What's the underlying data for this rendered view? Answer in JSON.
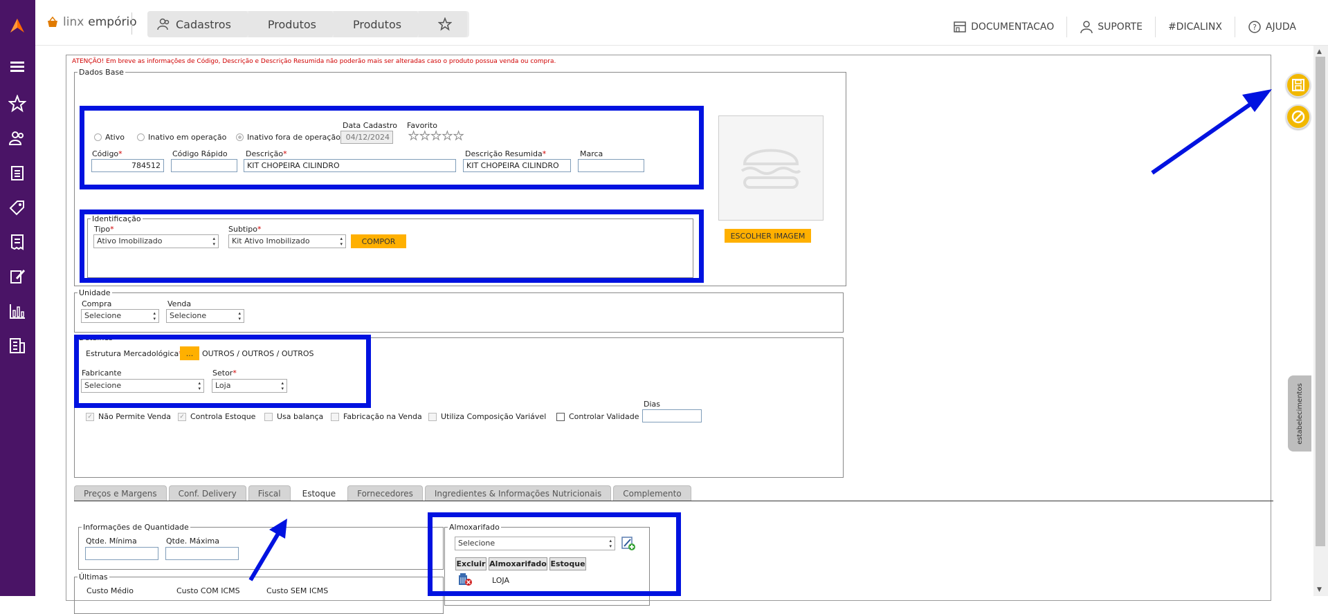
{
  "app": {
    "brand_left": "linx",
    "brand_right": "empório"
  },
  "breadcrumb": [
    "Cadastros",
    "Produtos",
    "Produtos"
  ],
  "top_links": {
    "docs": "DOCUMENTACAO",
    "support": "SUPORTE",
    "dica": "#DICALINX",
    "help": "AJUDA"
  },
  "sidebar_icons": [
    "menu-icon",
    "star-icon",
    "users-icon",
    "clipboard-icon",
    "tag-icon",
    "receipt-icon",
    "edit-doc-icon",
    "chart-icon",
    "building-icon"
  ],
  "warning": "ATENÇÃO! Em breve as informações de Código, Descrição e Descrição Resumida não poderão mais ser alteradas caso o produto possua venda ou compra.",
  "dados_base": {
    "legend": "Dados Base",
    "status_options": [
      "Ativo",
      "Inativo em operação",
      "Inativo fora de operação"
    ],
    "status_selected": "Inativo fora de operação",
    "data_cadastro_label": "Data Cadastro",
    "data_cadastro": "04/12/2024",
    "favorito_label": "Favorito",
    "favorito_rating": 0,
    "codigo_label": "Código",
    "codigo": "784512",
    "codigo_rapido_label": "Código Rápido",
    "codigo_rapido": "",
    "descricao_label": "Descrição",
    "descricao": "KIT CHOPEIRA CILINDRO",
    "descricao_resumida_label": "Descrição Resumida",
    "descricao_resumida": "KIT CHOPEIRA CILINDRO",
    "marca_label": "Marca",
    "marca": "",
    "escolher_imagem": "ESCOLHER IMAGEM"
  },
  "identificacao": {
    "legend": "Identificação",
    "tipo_label": "Tipo",
    "tipo": "Ativo Imobilizado",
    "subtipo_label": "Subtipo",
    "subtipo": "Kit Ativo Imobilizado",
    "compor": "COMPOR"
  },
  "unidade": {
    "legend": "Unidade",
    "compra_label": "Compra",
    "compra": "Selecione",
    "venda_label": "Venda",
    "venda": "Selecione"
  },
  "detalhes": {
    "legend": "Detalhes",
    "estrutura_label": "Estrutura Mercadológica",
    "estrutura_btn": "...",
    "estrutura_value": "OUTROS / OUTROS / OUTROS",
    "fabricante_label": "Fabricante",
    "fabricante": "Selecione",
    "setor_label": "Setor",
    "setor": "Loja",
    "checks": [
      {
        "label": "Não Permite Venda",
        "checked": true,
        "enabled": false
      },
      {
        "label": "Controla Estoque",
        "checked": true,
        "enabled": false
      },
      {
        "label": "Usa balança",
        "checked": false,
        "enabled": false
      },
      {
        "label": "Fabricação na Venda",
        "checked": false,
        "enabled": false
      },
      {
        "label": "Utiliza Composição Variável",
        "checked": false,
        "enabled": false
      },
      {
        "label": "Controlar Validade",
        "checked": false,
        "enabled": true
      }
    ],
    "dias_label": "Dias",
    "dias": ""
  },
  "tabs": [
    "Preços e Margens",
    "Conf. Delivery",
    "Fiscal",
    "Estoque",
    "Fornecedores",
    "Ingredientes & Informações Nutricionais",
    "Complemento"
  ],
  "active_tab": "Estoque",
  "quantidade": {
    "legend": "Informações de Quantidade",
    "min_label": "Qtde. Mínima",
    "min": "",
    "max_label": "Qtde. Máxima",
    "max": ""
  },
  "ultimas": {
    "legend": "Últimas",
    "custo_medio": "Custo Médio",
    "custo_com": "Custo COM ICMS",
    "custo_sem": "Custo SEM ICMS"
  },
  "almoxarifado": {
    "legend": "Almoxarifado",
    "select": "Selecione",
    "headers": [
      "Excluir",
      "Almoxarifado",
      "Estoque"
    ],
    "rows": [
      {
        "name": "LOJA"
      }
    ]
  },
  "side_tab": "estabelecimentos",
  "colors": {
    "sidebar": "#4a1466",
    "accent": "#ffb000",
    "annotation": "#0012e0",
    "required": "#d00000"
  }
}
